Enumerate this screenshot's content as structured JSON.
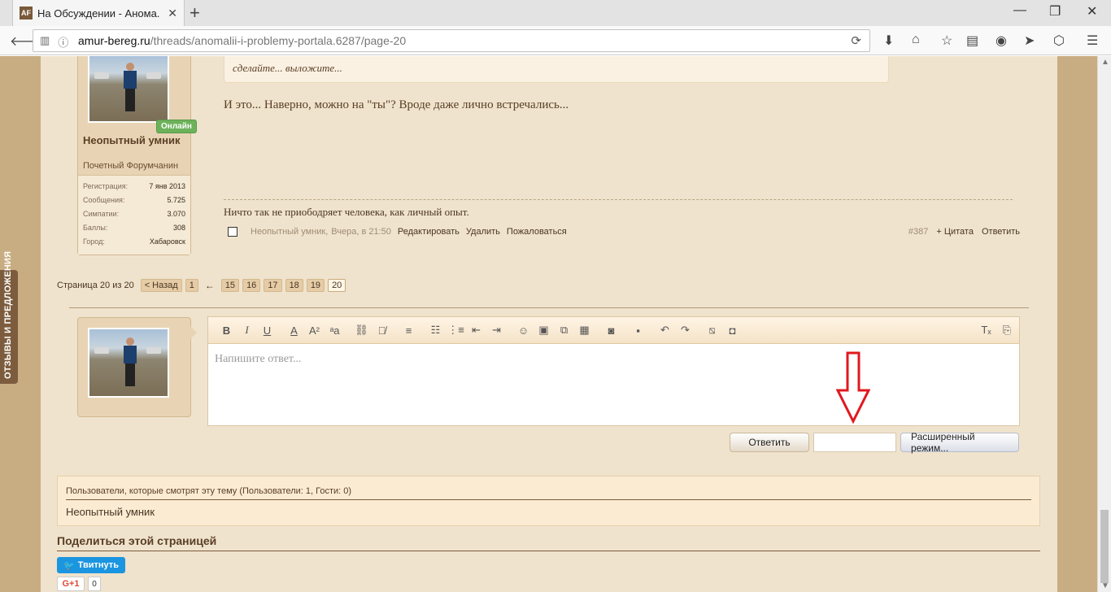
{
  "browser": {
    "tab_title": "На Обсуждении - Анома...",
    "favicon_text": "AF",
    "url_host": "amur-bereg.ru",
    "url_path": "/threads/anomalii-i-problemy-portala.6287/page-20"
  },
  "sidebar_feedback": "ОТЗЫВЫ И ПРЕДЛОЖЕНИЯ",
  "user": {
    "online_label": "Онлайн",
    "name": "Неопытный умник",
    "title": "Почетный Форумчанин",
    "stats": [
      {
        "key": "Регистрация:",
        "value": "7 янв 2013"
      },
      {
        "key": "Сообщения:",
        "value": "5.725"
      },
      {
        "key": "Симпатии:",
        "value": "3.070"
      },
      {
        "key": "Баллы:",
        "value": "308"
      },
      {
        "key": "Город:",
        "value": "Хабаровск"
      }
    ]
  },
  "post": {
    "quote_text": "сделайте... выложите...",
    "body": "И это... Наверно, можно на \"ты\"? Вроде даже лично встречались...",
    "signature": "Ничто так не приободряет человека, как личный опыт.",
    "author": "Неопытный умник,",
    "date": "Вчера, в 21:50",
    "edit": "Редактировать",
    "delete": "Удалить",
    "report": "Пожаловаться",
    "number": "#387",
    "quote": "+ Цитата",
    "reply": "Ответить"
  },
  "pagination": {
    "label": "Страница 20 из 20",
    "prev": "< Назад",
    "first": "1",
    "ellipsis": "←",
    "pages": [
      "15",
      "16",
      "17",
      "18",
      "19"
    ],
    "current": "20"
  },
  "editor": {
    "placeholder": "Напишите ответ..."
  },
  "buttons": {
    "reply": "Ответить",
    "advanced": "Расширенный режим..."
  },
  "viewers": {
    "heading": "Пользователи, которые смотрят эту тему (Пользователи: 1, Гости: 0)",
    "users": "Неопытный умник"
  },
  "share": {
    "title": "Поделиться этой страницей",
    "tweet": "Твитнуть",
    "gplus": "G+1",
    "gplus_count": "0"
  }
}
